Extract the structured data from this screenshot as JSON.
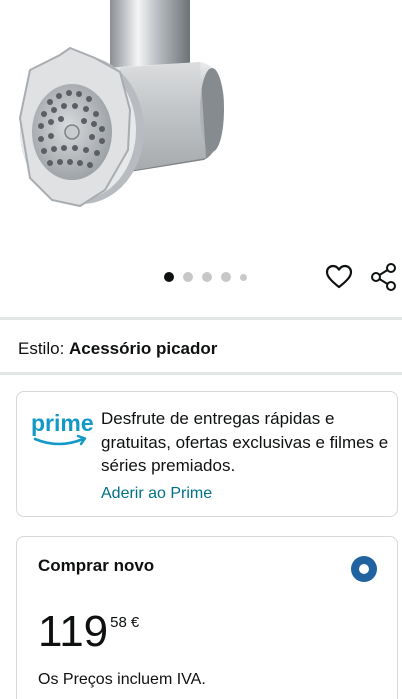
{
  "product": {
    "image_alt": "Acessório picador de carne metálico",
    "carousel": {
      "total_images": 5,
      "active_index": 0
    }
  },
  "style": {
    "label": "Estilo:",
    "value": "Acessório picador"
  },
  "prime": {
    "logo_text": "prime",
    "description": "Desfrute de entregas rápidas e gratuitas, ofertas exclusivas e filmes e séries premiados.",
    "link_label": "Aderir ao Prime"
  },
  "buy_new": {
    "title": "Comprar novo",
    "selected": true,
    "price_whole": "119",
    "price_fraction": "58",
    "currency": "€",
    "vat_note": "Os Preços incluem IVA."
  },
  "colors": {
    "link": "#007185",
    "radio": "#2162a1",
    "prime_blue": "#1399c6",
    "border": "#d5d9d9"
  },
  "icons": [
    "heart-icon",
    "share-icon"
  ]
}
